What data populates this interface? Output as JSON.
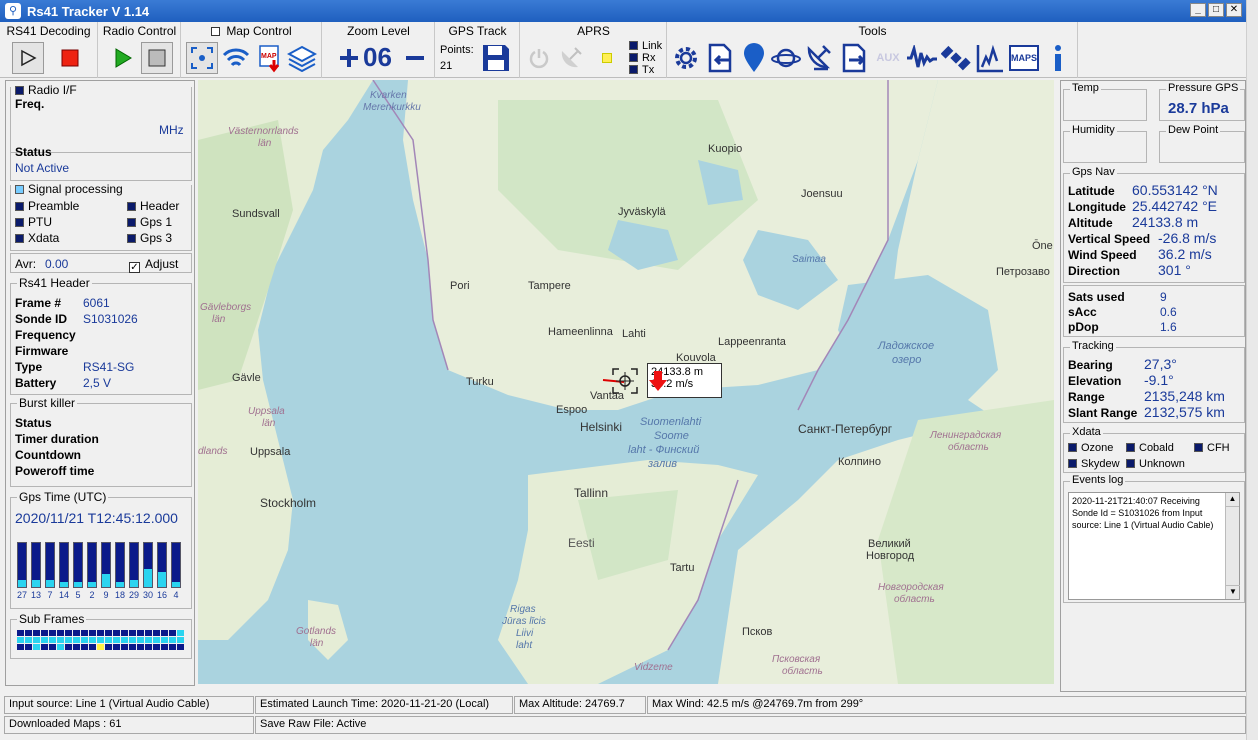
{
  "window": {
    "title": "Rs41 Tracker V 1.14"
  },
  "toolbar": {
    "groups": {
      "rs41_decoding": "RS41 Decoding",
      "radio_control": "Radio Control",
      "map_control": "Map Control",
      "zoom_level": "Zoom Level",
      "gps_track": "GPS Track",
      "aprs": "APRS",
      "tools": "Tools"
    },
    "zoom_value": "06",
    "gps_points_label": "Points:",
    "gps_points_value": "21",
    "aprs_indicators": [
      "Link",
      "Rx",
      "Tx"
    ],
    "map_icon_text": "MAP",
    "maps_button_text": "MAPS",
    "aux_text": "AUX"
  },
  "left": {
    "radio": {
      "title": "Radio I/F",
      "freq_label": "Freq.",
      "freq_unit": "MHz",
      "status_label": "Status",
      "status_value": "Not Active"
    },
    "signal": {
      "title": "Signal processing",
      "items": [
        "Preamble",
        "Header",
        "PTU",
        "Gps 1",
        "Xdata",
        "Gps 3"
      ],
      "avr_label": "Avr:",
      "avr_value": "0.00",
      "adjust_label": "Adjust"
    },
    "header": {
      "title": "Rs41 Header",
      "rows": [
        {
          "label": "Frame #",
          "value": "6061"
        },
        {
          "label": "Sonde ID",
          "value": "S1031026"
        },
        {
          "label": "Frequency",
          "value": ""
        },
        {
          "label": "Firmware",
          "value": ""
        },
        {
          "label": "Type",
          "value": "RS41-SG"
        },
        {
          "label": "Battery",
          "value": "2,5 V"
        }
      ]
    },
    "burst": {
      "title": "Burst killer",
      "rows": [
        "Status",
        "Timer duration",
        "Countdown",
        "Poweroff time"
      ]
    },
    "gps_time": {
      "title": "Gps Time (UTC)",
      "value": "2020/11/21 T12:45:12.000",
      "sat_bars": [
        {
          "id": "27",
          "level": 0.15
        },
        {
          "id": "13",
          "level": 0.15
        },
        {
          "id": "7",
          "level": 0.15
        },
        {
          "id": "14",
          "level": 0.12
        },
        {
          "id": "5",
          "level": 0.12
        },
        {
          "id": "2",
          "level": 0.12
        },
        {
          "id": "9",
          "level": 0.3
        },
        {
          "id": "18",
          "level": 0.12
        },
        {
          "id": "29",
          "level": 0.15
        },
        {
          "id": "30",
          "level": 0.4
        },
        {
          "id": "16",
          "level": 0.35
        },
        {
          "id": "4",
          "level": 0.12
        }
      ]
    },
    "subframes": {
      "title": "Sub Frames"
    }
  },
  "map": {
    "callout_altitude": "24133.8 m",
    "callout_speed": "36.2 m/s",
    "labels": [
      "Kvarken",
      "Merenkurkku",
      "Västernorrlands",
      "län",
      "Kuopio",
      "Jyväskylä",
      "Joensuu",
      "Sundsvall",
      "Pori",
      "Tampere",
      "Hameenlinna",
      "Lahti",
      "Lappeenranta",
      "Kouvola",
      "Gävle",
      "Turku",
      "Espoo",
      "Vantaa",
      "Helsinki",
      "Gävleborgs",
      "län",
      "Uppsala",
      "län",
      "Uppsala",
      "Stockholm",
      "Tallinn",
      "Eesti",
      "Tartu",
      "Санкт-Петербург",
      "Колпино",
      "Великий",
      "Новгород",
      "Псков",
      "Петрозаво",
      "Saimaa",
      "Ладожское",
      "озеро",
      "Suomenlahti",
      "Soome",
      "laht - Финский",
      "залив",
      "Ленинградская",
      "область",
      "Новгородская",
      "область",
      "Псковская",
      "область",
      "Gotlands",
      "län",
      "Rigas",
      "Jūras līcis",
      "Liivi",
      "laht",
      "Vidzeme",
      "dlands",
      "Ōne"
    ]
  },
  "right": {
    "temp_label": "Temp",
    "pressure_label": "Pressure GPS",
    "pressure_value": "28.7 hPa",
    "humidity_label": "Humidity",
    "dewpoint_label": "Dew Point",
    "gps_nav": {
      "title": "Gps Nav",
      "rows": [
        {
          "label": "Latitude",
          "value": "60.553142 °N"
        },
        {
          "label": "Longitude",
          "value": "25.442742 °E"
        },
        {
          "label": "Altitude",
          "value": "24133.8 m"
        },
        {
          "label": "Vertical Speed",
          "value": "-26.8 m/s"
        },
        {
          "label": "Wind Speed",
          "value": "36.2 m/s"
        },
        {
          "label": "Direction",
          "value": "301 °"
        }
      ],
      "sats_rows": [
        {
          "label": "Sats used",
          "value": "9"
        },
        {
          "label": "sAcc",
          "value": "0.6"
        },
        {
          "label": "pDop",
          "value": "1.6"
        }
      ]
    },
    "tracking": {
      "title": "Tracking",
      "rows": [
        {
          "label": "Bearing",
          "value": "27,3°"
        },
        {
          "label": "Elevation",
          "value": "-9.1°"
        },
        {
          "label": "Range",
          "value": "2135,248 km"
        },
        {
          "label": "Slant Range",
          "value": "2132,575 km"
        }
      ]
    },
    "xdata": {
      "title": "Xdata",
      "items": [
        "Ozone",
        "Cobald",
        "CFH",
        "Skydew",
        "Unknown"
      ]
    },
    "events": {
      "title": "Events log",
      "text": "2020-11-21T21:40:07 Receiving Sonde Id = S1031026 from Input source: Line 1 (Virtual Audio Cable)"
    }
  },
  "statusbar": {
    "input_source": "Input source: Line 1 (Virtual Audio Cable)",
    "launch_time": "Estimated Launch Time: 2020-11-21-20 (Local)",
    "max_altitude": "Max Altitude: 24769.7",
    "max_wind": "Max Wind: 42.5 m/s @24769.7m from 299°",
    "downloaded_maps": "Downloaded Maps : 61",
    "raw_file": "Save Raw File: Active"
  }
}
